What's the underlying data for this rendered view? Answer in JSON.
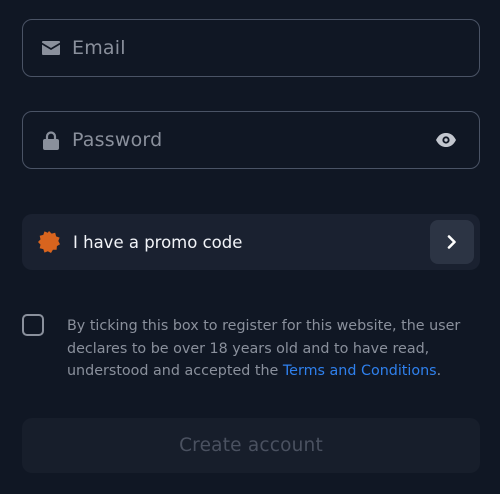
{
  "email_field": {
    "placeholder": "Email",
    "icon": "envelope-icon"
  },
  "password_field": {
    "placeholder": "Password",
    "icon": "lock-icon",
    "toggle_icon": "eye-icon"
  },
  "promo": {
    "label": "I have a promo code",
    "icon": "promo-badge-icon",
    "action_icon": "chevron-right-icon"
  },
  "consent": {
    "text_before": "By ticking this box to register for this website, the user declares to be over 18 years old and to have read, understood and accepted the ",
    "link_text": "Terms and Conditions",
    "text_after": "."
  },
  "create_account": {
    "label": "Create account"
  },
  "colors": {
    "background": "#101724",
    "field_border": "#4a5365",
    "promo_bg": "#1a2130",
    "badge_orange": "#d8641e",
    "link_blue": "#2f80ed",
    "disabled_text": "#4a5160"
  }
}
